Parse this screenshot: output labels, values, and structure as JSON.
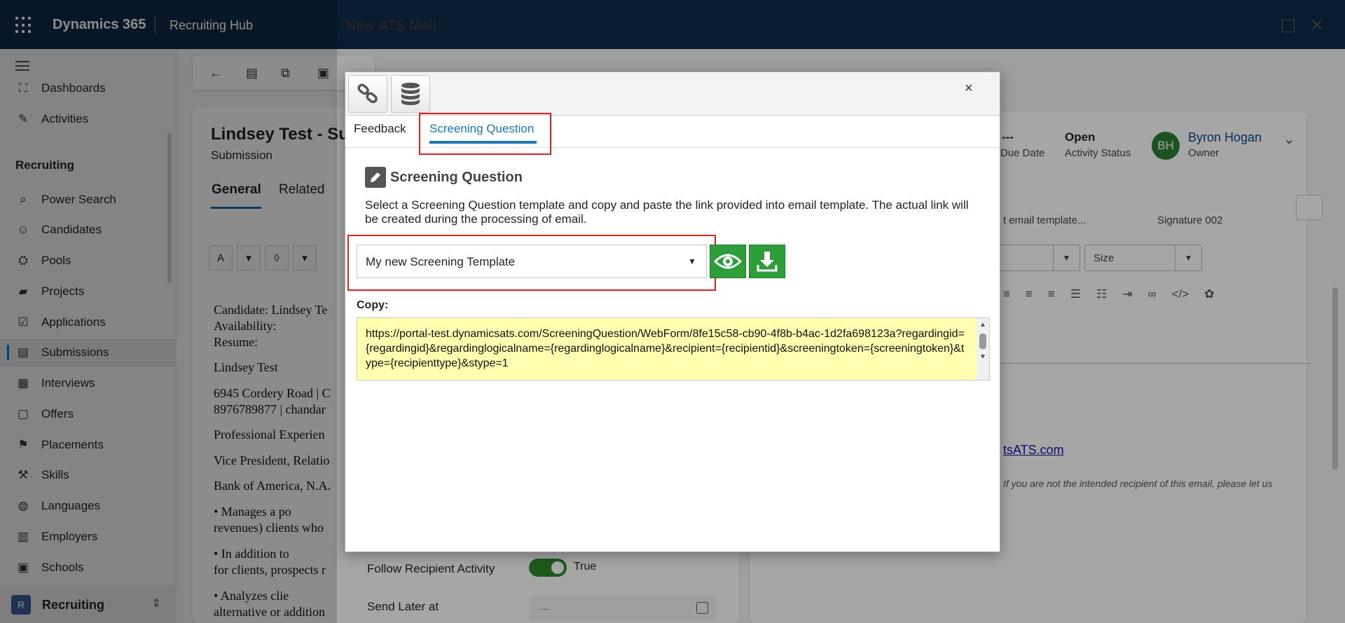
{
  "topbar": {
    "brand": "Dynamics 365",
    "app": "Recruiting Hub"
  },
  "sidebar": {
    "items": [
      {
        "label": "Dashboards",
        "icon": "⛶"
      },
      {
        "label": "Activities",
        "icon": "✎"
      }
    ],
    "section": "Recruiting",
    "recruiting_items": [
      {
        "label": "Power Search",
        "icon": "⌕"
      },
      {
        "label": "Candidates",
        "icon": "☺"
      },
      {
        "label": "Pools",
        "icon": "⛭"
      },
      {
        "label": "Projects",
        "icon": "▰"
      },
      {
        "label": "Applications",
        "icon": "☑"
      },
      {
        "label": "Submissions",
        "icon": "▤"
      },
      {
        "label": "Interviews",
        "icon": "▦"
      },
      {
        "label": "Offers",
        "icon": "▢"
      },
      {
        "label": "Placements",
        "icon": "⚑"
      },
      {
        "label": "Skills",
        "icon": "⚒"
      },
      {
        "label": "Languages",
        "icon": "◍"
      },
      {
        "label": "Employers",
        "icon": "▥"
      },
      {
        "label": "Schools",
        "icon": "▣"
      }
    ],
    "area": {
      "badge": "R",
      "label": "Recruiting"
    }
  },
  "record": {
    "title": "Lindsey Test - Su",
    "subtitle": "Submission",
    "tabs": [
      "General",
      "Related"
    ],
    "doc_lines": [
      "Candidate: Lindsey Te",
      "Availability:",
      "Resume:",
      "Lindsey Test",
      "6945 Cordery Road | C",
      "8976789877 | chandar",
      "Professional Experien",
      "Vice President, Relatio",
      "Bank of America, N.A.",
      "•        Manages a po",
      "revenues) clients who",
      "•        In addition to",
      "for clients, prospects r",
      "•        Analyzes clie",
      "alternative or addition"
    ],
    "follow_label": "Follow Recipient Activity",
    "follow_value": "True",
    "send_later_label": "Send Later at",
    "send_later_value": "---"
  },
  "right": {
    "due_value": "---",
    "due_label": "Due Date",
    "status_value": "Open",
    "status_label": "Activity Status",
    "owner_initials": "BH",
    "owner_name": "Byron Hogan",
    "owner_label": "Owner",
    "template_field": "t email template...",
    "signature_field": "Signature 002",
    "size_field": "Size",
    "email_link": "tsATS.com",
    "disclaimer": "If you are not the intended recipient of this email, please let us"
  },
  "panel": {
    "title": "New ATS Mail"
  },
  "dialog": {
    "tabs": {
      "feedback": "Feedback",
      "screening": "Screening Question"
    },
    "heading": "Screening Question",
    "description": "Select a Screening Question template and copy and paste the link provided into email template. The actual link will be created during the processing of email.",
    "selected_template": "My new Screening Template",
    "copy_label": "Copy:",
    "copy_value": "https://portal-test.dynamicsats.com/ScreeningQuestion/WebForm/8fe15c58-cb90-4f8b-b4ac-1d2fa698123a?regardingid={regardingid}&regardinglogicalname={regardinglogicalname}&recipient={recipientid}&screeningtoken={screeningtoken}&type={recipienttype}&stype=1",
    "close": "×",
    "colors": {
      "accent": "#1e76b5",
      "highlight": "#e02020",
      "button_green": "#2d9e3a",
      "copy_bg": "#ffffb0"
    }
  }
}
